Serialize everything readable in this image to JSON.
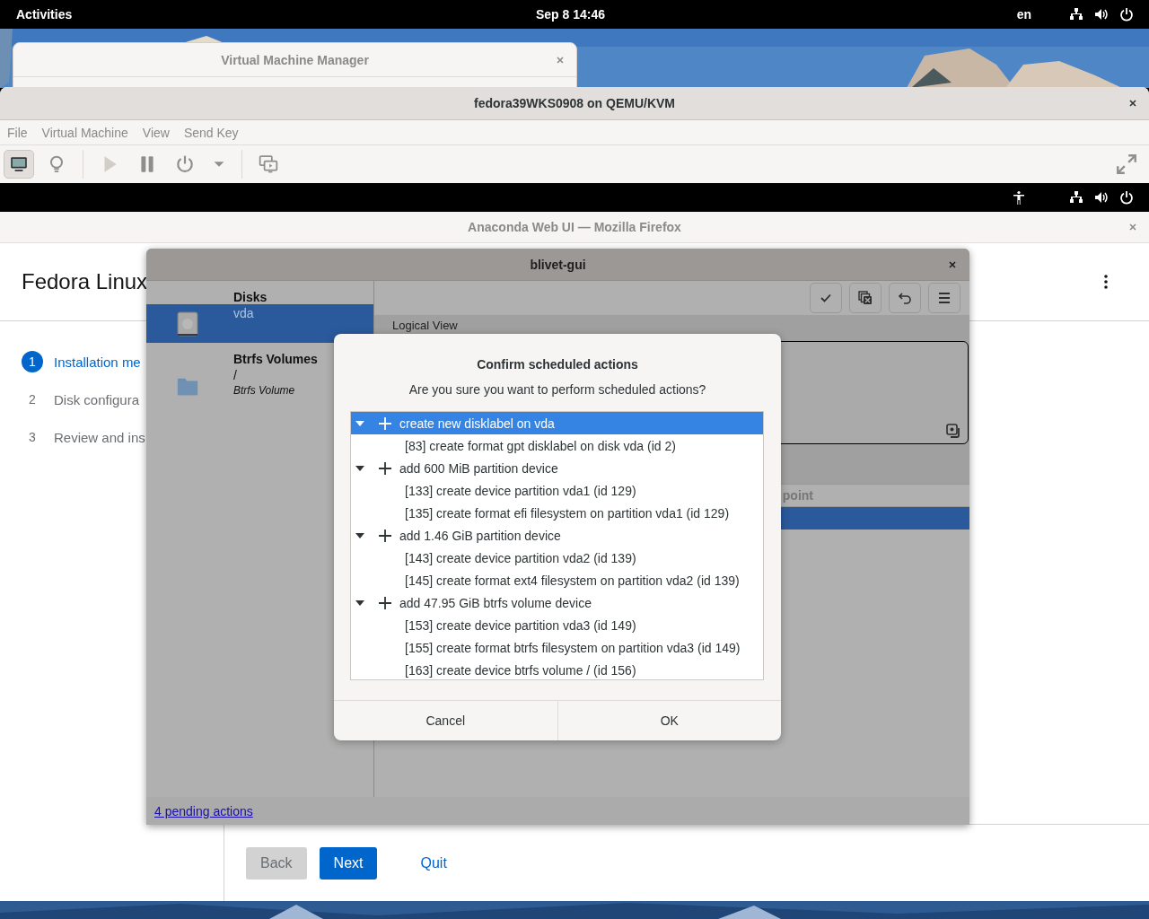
{
  "top_bar": {
    "activities": "Activities",
    "clock": "Sep 8  14:46",
    "language": "en"
  },
  "background_window": {
    "title": "Virtual Machine Manager"
  },
  "vm_window": {
    "title": "fedora39WKS0908 on QEMU/KVM",
    "menu": [
      "File",
      "Virtual Machine",
      "View",
      "Send Key"
    ],
    "toolbar_groups": [
      {
        "buttons": [
          {
            "kind": "console",
            "selected": true,
            "disabled": false
          },
          {
            "kind": "details",
            "selected": false,
            "disabled": false
          }
        ]
      },
      {
        "buttons": [
          {
            "kind": "run",
            "selected": false,
            "disabled": true
          },
          {
            "kind": "pause",
            "selected": false,
            "disabled": false
          },
          {
            "kind": "shutdown",
            "selected": false,
            "disabled": false
          },
          {
            "kind": "caret",
            "selected": false,
            "disabled": false
          }
        ]
      },
      {
        "buttons": [
          {
            "kind": "snapshots",
            "selected": false,
            "disabled": false
          }
        ]
      }
    ]
  },
  "guest": {
    "browser_title": "Anaconda Web UI — Mozilla Firefox",
    "page": {
      "brand": "Fedora Linux",
      "steps": [
        {
          "number": "1",
          "label": "Installation me",
          "selected": true
        },
        {
          "number": "2",
          "label": "Disk configura",
          "selected": false
        },
        {
          "number": "3",
          "label": "Review and ins",
          "selected": false
        }
      ],
      "back": {
        "label": "Back",
        "disabled": true
      },
      "next": "Next",
      "quit": "Quit"
    }
  },
  "blivet": {
    "title": "blivet-gui",
    "sidebar": [
      {
        "heading": "Disks",
        "items": [
          {
            "kind": "disk",
            "name": "vda",
            "selected": true
          }
        ]
      },
      {
        "heading": "Btrfs Volumes",
        "items": [
          {
            "kind": "folder",
            "name": "/",
            "subtitle": "Btrfs Volume",
            "selected": false
          }
        ]
      }
    ],
    "view_label": "Logical View",
    "column_header": "point",
    "pending_link": "4 pending actions"
  },
  "dialog": {
    "title": "Confirm scheduled actions",
    "message": "Are you sure you want to perform scheduled actions?",
    "actions": [
      {
        "label": "create new disklabel on vda",
        "selected": true,
        "expanded": true,
        "children": [
          {
            "label": "[83] create format gpt disklabel on disk vda (id 2)",
            "selected": false
          }
        ]
      },
      {
        "label": "add 600 MiB partition device",
        "selected": false,
        "expanded": true,
        "children": [
          {
            "label": "[133] create device partition vda1 (id 129)",
            "selected": false
          },
          {
            "label": "[135] create format efi filesystem on partition vda1 (id 129)",
            "selected": false
          }
        ]
      },
      {
        "label": "add 1.46 GiB partition device",
        "selected": false,
        "expanded": true,
        "children": [
          {
            "label": "[143] create device partition vda2 (id 139)",
            "selected": false
          },
          {
            "label": "[145] create format ext4 filesystem on partition vda2 (id 139)",
            "selected": false
          }
        ]
      },
      {
        "label": "add 47.95 GiB btrfs volume device",
        "selected": false,
        "expanded": true,
        "children": [
          {
            "label": "[153] create device partition vda3 (id 149)",
            "selected": false
          },
          {
            "label": "[155] create format btrfs filesystem on partition vda3 (id 149)",
            "selected": false
          },
          {
            "label": "[163] create device btrfs volume / (id 156)",
            "selected": false
          }
        ]
      }
    ],
    "buttons": [
      "Cancel",
      "OK"
    ]
  }
}
